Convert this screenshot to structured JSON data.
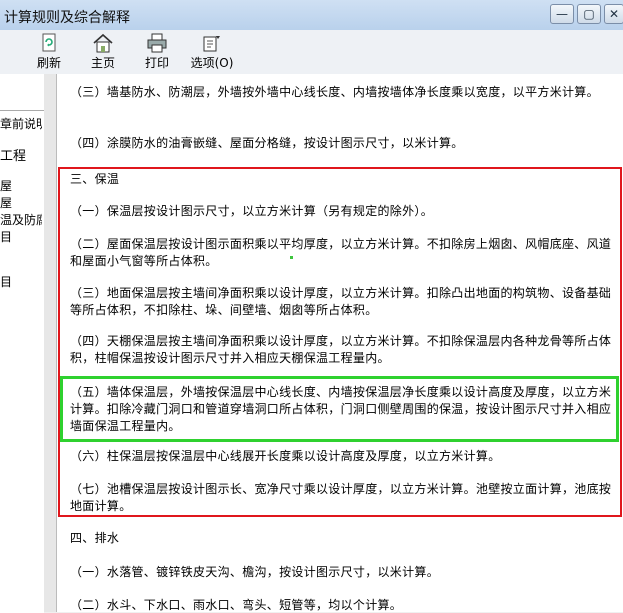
{
  "window": {
    "title": "计算规则及综合解释",
    "min_glyph": "—",
    "max_glyph": "▢",
    "close_glyph": "✕"
  },
  "toolbar": {
    "refresh": "刷新",
    "home": "主页",
    "print": "打印",
    "options": "选项(O)"
  },
  "left_panel": {
    "items": [
      "章前说明",
      "工程",
      "",
      "屋",
      "屋",
      "温及防腐",
      "目",
      "",
      "目"
    ]
  },
  "content": {
    "p_wall_base": "（三）墙基防水、防潮层，外墙按外墙中心线长度、内墙按墙体净长度乘以宽度，以平方米计算。",
    "p_coating": "（四）涂膜防水的油膏嵌缝、屋面分格缝，按设计图示尺寸，以米计算。",
    "section3_title": "三、保温",
    "p_insul_1": "（一）保温层按设计图示尺寸，以立方米计算（另有规定的除外）。",
    "p_insul_2": "（二）屋面保温层按设计图示面积乘以平均厚度，以立方米计算。不扣除房上烟囱、风帽底座、风道和屋面小气窗等所占体积。",
    "p_insul_3": "（三）地面保温层按主墙间净面积乘以设计厚度，以立方米计算。扣除凸出地面的构筑物、设备基础等所占体积，不扣除柱、垛、间壁墙、烟囱等所占体积。",
    "p_insul_4": "（四）天棚保温层按主墙间净面积乘以设计厚度，以立方米计算。不扣除保温层内各种龙骨等所占体积，柱帽保温按设计图示尺寸并入相应天棚保温工程量内。",
    "p_insul_5": "（五）墙体保温层，外墙按保温层中心线长度、内墙按保温层净长度乘以设计高度及厚度，以立方米计算。扣除冷藏门洞口和管道穿墙洞口所占体积，门洞口侧壁周围的保温，按设计图示尺寸并入相应墙面保温工程量内。",
    "p_insul_6": "（六）柱保温层按保温层中心线展开长度乘以设计高度及厚度，以立方米计算。",
    "p_insul_7": "（七）池槽保温层按设计图示长、宽净尺寸乘以设计厚度，以立方米计算。池壁按立面计算，池底按地面计算。",
    "section4_title": "四、排水",
    "p_drain_1": "（一）水落管、镀锌铁皮天沟、檐沟，按设计图示尺寸，以米计算。",
    "p_drain_2": "（二）水斗、下水口、雨水口、弯头、短管等，均以个计算。"
  },
  "colors": {
    "highlight_red": "#e0161c",
    "highlight_green": "#2fd12f"
  }
}
